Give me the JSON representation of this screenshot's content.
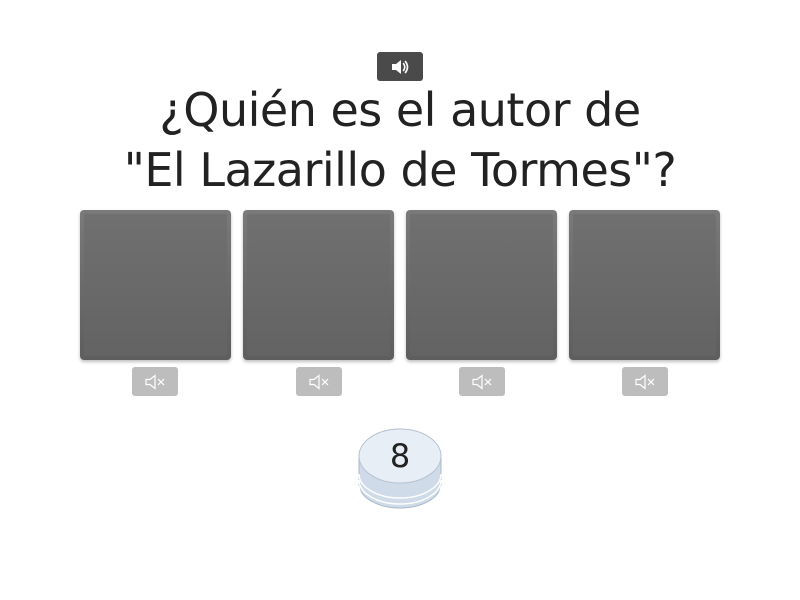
{
  "question": {
    "line1": "¿Quién es el autor de",
    "line2": "\"El Lazarillo de Tormes\"?"
  },
  "toolbar": {
    "speak_icon": "speaker-icon"
  },
  "tiles": [
    {
      "label": "",
      "mute_icon": "speaker-muted-icon"
    },
    {
      "label": "",
      "mute_icon": "speaker-muted-icon"
    },
    {
      "label": "",
      "mute_icon": "speaker-muted-icon"
    },
    {
      "label": "",
      "mute_icon": "speaker-muted-icon"
    }
  ],
  "counter": {
    "value": "8"
  },
  "colors": {
    "tile": "#6b6b6b",
    "speak_button": "#4a4a4a",
    "mute_button": "#bdbdbd",
    "counter_top": "#e8eef6",
    "counter_stack": "#cfdbe9"
  }
}
